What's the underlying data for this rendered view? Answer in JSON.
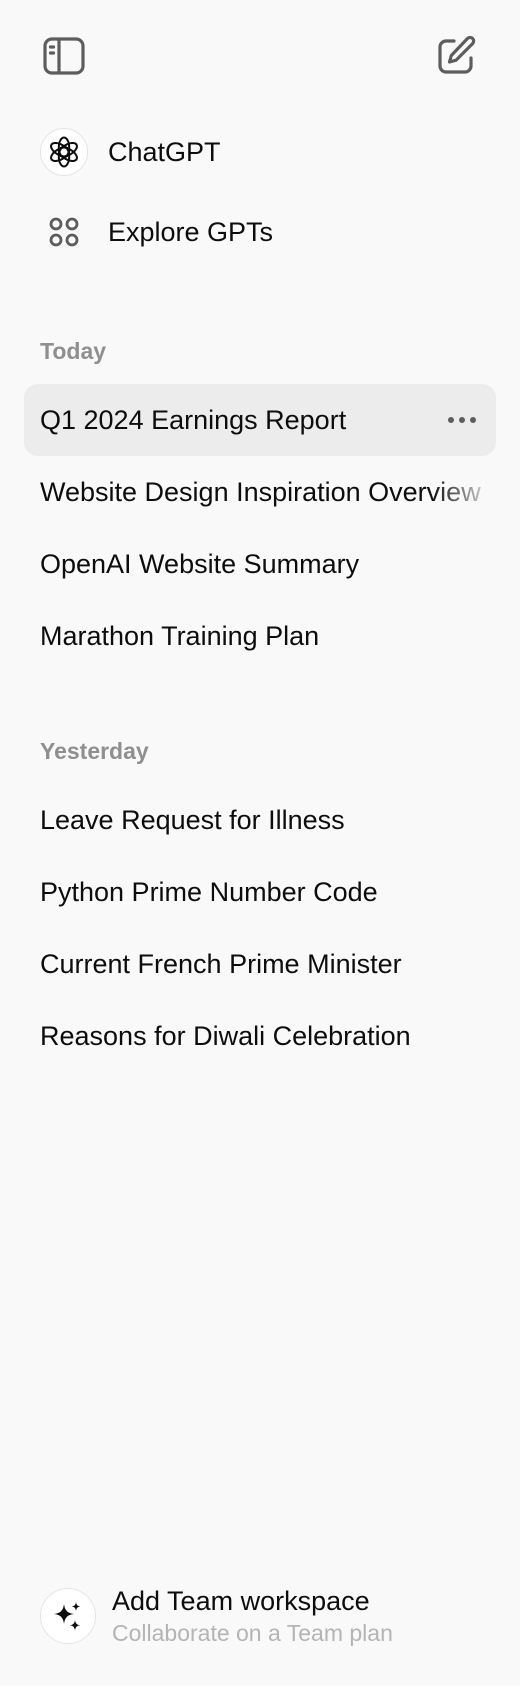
{
  "nav": {
    "chatgpt_label": "ChatGPT",
    "explore_label": "Explore GPTs"
  },
  "sections": {
    "today": {
      "title": "Today",
      "items": [
        "Q1 2024 Earnings Report",
        "Website Design Inspiration Overview",
        "OpenAI Website Summary",
        "Marathon Training Plan"
      ]
    },
    "yesterday": {
      "title": "Yesterday",
      "items": [
        "Leave Request for Illness",
        "Python Prime Number Code",
        "Current French Prime Minister",
        "Reasons for Diwali Celebration"
      ]
    }
  },
  "footer": {
    "title": "Add Team workspace",
    "subtitle": "Collaborate on a Team plan"
  },
  "icons": {
    "sidebar_toggle": "sidebar-toggle-icon",
    "new_chat": "new-chat-icon",
    "chatgpt": "openai-logo-icon",
    "explore": "grid-dots-icon",
    "more": "ellipsis-icon",
    "team": "sparkles-icon"
  },
  "colors": {
    "background": "#f9f9f9",
    "active_item": "#ececec",
    "section_title": "#8f8f8f",
    "icon": "#5d5d5d",
    "subtitle": "#b4b4b4"
  }
}
